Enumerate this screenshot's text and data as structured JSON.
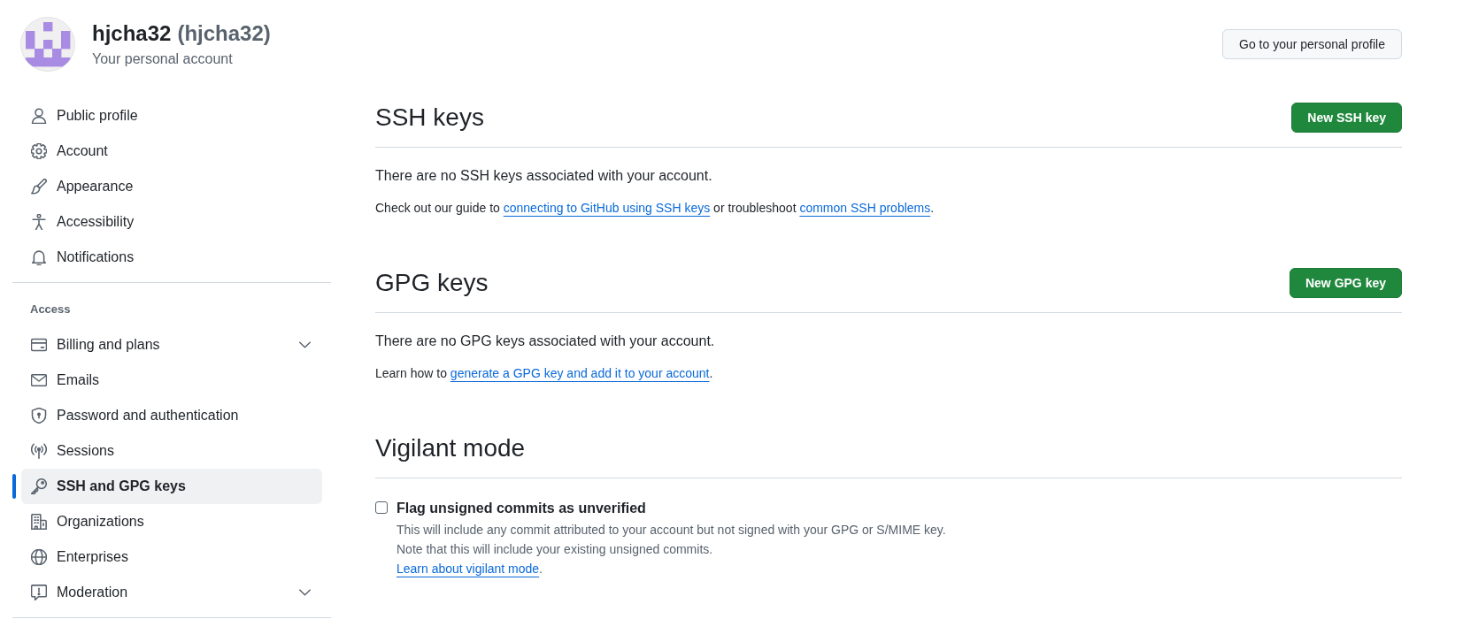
{
  "account": {
    "name": "hjcha32",
    "login": "(hjcha32)",
    "subtitle": "Your personal account",
    "profile_button": "Go to your personal profile"
  },
  "sidebar": {
    "groups": [
      {
        "items": [
          {
            "label": "Public profile",
            "selected": false,
            "expandable": false
          },
          {
            "label": "Account",
            "selected": false,
            "expandable": false
          },
          {
            "label": "Appearance",
            "selected": false,
            "expandable": false
          },
          {
            "label": "Accessibility",
            "selected": false,
            "expandable": false
          },
          {
            "label": "Notifications",
            "selected": false,
            "expandable": false
          }
        ]
      },
      {
        "heading": "Access",
        "items": [
          {
            "label": "Billing and plans",
            "selected": false,
            "expandable": true
          },
          {
            "label": "Emails",
            "selected": false,
            "expandable": false
          },
          {
            "label": "Password and authentication",
            "selected": false,
            "expandable": false
          },
          {
            "label": "Sessions",
            "selected": false,
            "expandable": false
          },
          {
            "label": "SSH and GPG keys",
            "selected": true,
            "expandable": false
          },
          {
            "label": "Organizations",
            "selected": false,
            "expandable": false
          },
          {
            "label": "Enterprises",
            "selected": false,
            "expandable": false
          },
          {
            "label": "Moderation",
            "selected": false,
            "expandable": true
          }
        ]
      }
    ]
  },
  "ssh_keys": {
    "title": "SSH keys",
    "button": "New SSH key",
    "message": "There are no SSH keys associated with your account.",
    "help": [
      {
        "kind": "text",
        "text": "Check out our guide to "
      },
      {
        "kind": "link",
        "text": "connecting to GitHub using SSH keys"
      },
      {
        "kind": "text",
        "text": " or troubleshoot "
      },
      {
        "kind": "link",
        "text": "common SSH problems"
      },
      {
        "kind": "text",
        "text": "."
      }
    ]
  },
  "gpg_keys": {
    "title": "GPG keys",
    "button": "New GPG key",
    "message": "There are no GPG keys associated with your account.",
    "help": [
      {
        "kind": "text",
        "text": "Learn how to "
      },
      {
        "kind": "link",
        "text": "generate a GPG key and add it to your account"
      },
      {
        "kind": "text",
        "text": "."
      }
    ]
  },
  "vigilant_mode": {
    "title": "Vigilant mode",
    "option": {
      "label": "Flag unsigned commits as unverified",
      "checked": false,
      "description": [
        "This will include any commit attributed to your account but not signed with your GPG or S/MIME key.",
        "Note that this will include your existing unsigned commits."
      ],
      "help": [
        {
          "kind": "link",
          "text": "Learn about vigilant mode"
        },
        {
          "kind": "text",
          "text": "."
        }
      ]
    }
  }
}
